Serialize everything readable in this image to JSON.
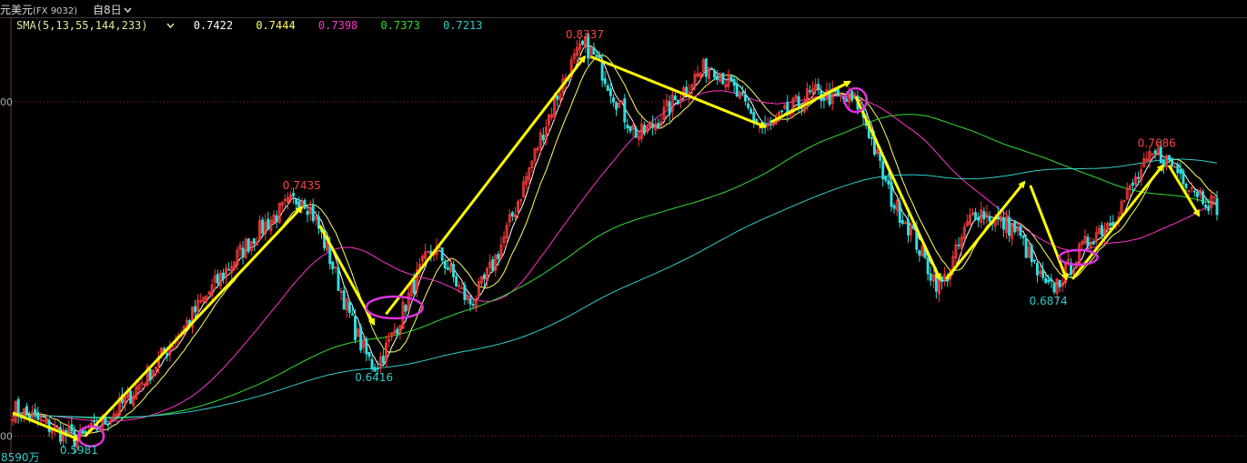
{
  "header": {
    "title": "元美元",
    "code": "(FX 9032)",
    "period": "自8日",
    "period_arrow": "chevron-down-icon"
  },
  "sma": {
    "label": "SMA(5,13,55,144,233)",
    "values": [
      {
        "text": "0.7422",
        "color": "#ffffff"
      },
      {
        "text": "0.7444",
        "color": "#ffff66"
      },
      {
        "text": "0.7398",
        "color": "#ff33cc"
      },
      {
        "text": "0.7373",
        "color": "#33dd33"
      },
      {
        "text": "0.7213",
        "color": "#33cccc"
      }
    ]
  },
  "axis": {
    "ticks": [
      {
        "text": "00",
        "value": 0.8
      },
      {
        "text": "00",
        "value": 0.6
      }
    ]
  },
  "labels": {
    "bottom_left": "8590万",
    "bottom_low": "0.5981"
  },
  "chart_data": {
    "type": "candlestick",
    "ylim": [
      0.584,
      0.85
    ],
    "x_range": [
      0,
      1000
    ],
    "up_color": "#ff3b3b",
    "down_color": "#33dddd",
    "grid": "red dotted horizontal lines at 0.80 and 0.60",
    "pivots": [
      {
        "x": 0,
        "y": 0.616
      },
      {
        "x": 55,
        "y": 0.5981,
        "label": "0.5981",
        "color": "#33cccc"
      },
      {
        "x": 240,
        "y": 0.7435,
        "label": "0.7435",
        "color": "#ff4444"
      },
      {
        "x": 300,
        "y": 0.6416,
        "label": "0.6416",
        "color": "#33cccc"
      },
      {
        "x": 350,
        "y": 0.712
      },
      {
        "x": 380,
        "y": 0.68
      },
      {
        "x": 475,
        "y": 0.8337,
        "label": "0.8337",
        "color": "#ff4444"
      },
      {
        "x": 520,
        "y": 0.78
      },
      {
        "x": 580,
        "y": 0.822
      },
      {
        "x": 625,
        "y": 0.784
      },
      {
        "x": 665,
        "y": 0.805
      },
      {
        "x": 700,
        "y": 0.8
      },
      {
        "x": 735,
        "y": 0.735
      },
      {
        "x": 770,
        "y": 0.69
      },
      {
        "x": 800,
        "y": 0.735
      },
      {
        "x": 830,
        "y": 0.725
      },
      {
        "x": 860,
        "y": 0.6874,
        "label": "0.6874",
        "color": "#33cccc"
      },
      {
        "x": 905,
        "y": 0.725
      },
      {
        "x": 950,
        "y": 0.7686,
        "label": "0.7686",
        "color": "#ff4444"
      },
      {
        "x": 1000,
        "y": 0.738
      }
    ],
    "series": [
      {
        "name": "SMA5",
        "color": "#ffffff",
        "value": 0.7422
      },
      {
        "name": "SMA13",
        "color": "#ffff66",
        "value": 0.7444
      },
      {
        "name": "SMA55",
        "color": "#ff33cc",
        "value": 0.7398
      },
      {
        "name": "SMA144",
        "color": "#33dd33",
        "value": 0.7373
      },
      {
        "name": "SMA233",
        "color": "#33cccc",
        "value": 0.7213
      }
    ],
    "trend_arrows": [
      [
        {
          "x": 0,
          "y": 0.614
        },
        {
          "x": 55,
          "y": 0.598
        }
      ],
      [
        {
          "x": 60,
          "y": 0.6
        },
        {
          "x": 240,
          "y": 0.737
        }
      ],
      [
        {
          "x": 255,
          "y": 0.726
        },
        {
          "x": 300,
          "y": 0.667
        }
      ],
      [
        {
          "x": 310,
          "y": 0.673
        },
        {
          "x": 475,
          "y": 0.827
        }
      ],
      [
        {
          "x": 480,
          "y": 0.827
        },
        {
          "x": 625,
          "y": 0.785
        }
      ],
      [
        {
          "x": 630,
          "y": 0.788
        },
        {
          "x": 695,
          "y": 0.812
        }
      ],
      [
        {
          "x": 700,
          "y": 0.803
        },
        {
          "x": 770,
          "y": 0.694
        }
      ],
      [
        {
          "x": 775,
          "y": 0.694
        },
        {
          "x": 840,
          "y": 0.752
        }
      ],
      [
        {
          "x": 845,
          "y": 0.75
        },
        {
          "x": 875,
          "y": 0.694
        }
      ],
      [
        {
          "x": 880,
          "y": 0.694
        },
        {
          "x": 955,
          "y": 0.762
        }
      ],
      [
        {
          "x": 960,
          "y": 0.762
        },
        {
          "x": 985,
          "y": 0.732
        }
      ]
    ],
    "circles": [
      {
        "x": 65,
        "y": 0.6,
        "rx": 14,
        "ry": 11
      },
      {
        "x": 317,
        "y": 0.677,
        "rx": 31,
        "ry": 12
      },
      {
        "x": 700,
        "y": 0.801,
        "rx": 12,
        "ry": 13
      },
      {
        "x": 885,
        "y": 0.707,
        "rx": 21,
        "ry": 8
      }
    ]
  }
}
